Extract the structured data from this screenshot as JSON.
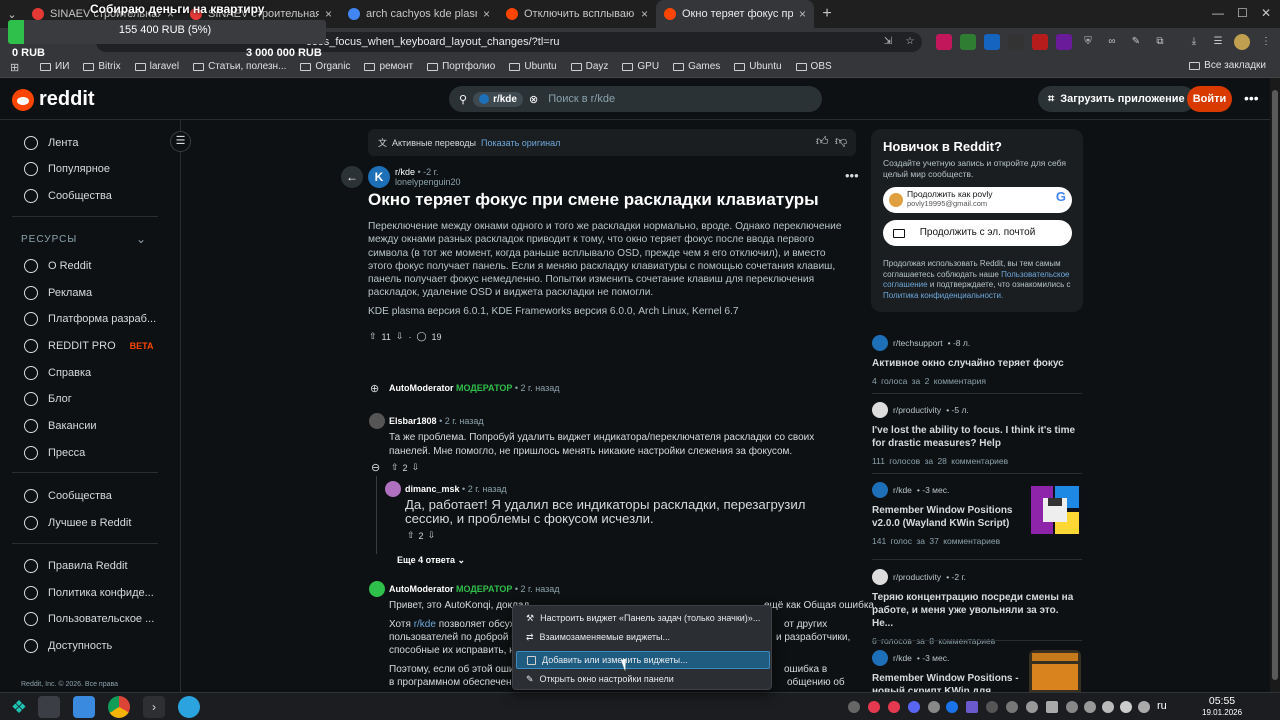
{
  "fundraiser": {
    "title": "Собираю деньги на квартиру",
    "current": "155 400 RUB (5%)",
    "progress_fraction": 0.05,
    "min": "0 RUB",
    "max": "3 000 000 RUB",
    "fill_color": "#2fbf4b"
  },
  "browser": {
    "tabs": [
      {
        "label": "SINAEV строительная к...",
        "icon_color": "#e53935"
      },
      {
        "label": "SINAEV строительная ком...",
        "icon_color": "#e53935"
      },
      {
        "label": "arch cachyos kde plasma k...",
        "icon_color": "#4285f4"
      },
      {
        "label": "Отключить всплывающ...",
        "icon_color": "#ff4500"
      },
      {
        "label": "Окно теряет фокус при см...",
        "icon_color": "#ff4500",
        "active": true
      }
    ],
    "url_visible": "oses_focus_when_keyboard_layout_changes/?tl=ru",
    "bookmarks": [
      "ИИ",
      "Bitrix",
      "laravel",
      "Статьи, полезн...",
      "Organic",
      "ремонт",
      "Портфолио",
      "Ubuntu",
      "Dayz",
      "GPU",
      "Games",
      "Ubuntu",
      "OBS"
    ],
    "all_bookmarks": "Все закладки"
  },
  "header": {
    "logo": "reddit",
    "search_chip": "r/kde",
    "search_placeholder": "Поиск в r/kde",
    "app_button": "Загрузить приложение",
    "login_button": "Войти"
  },
  "sidebar": {
    "main": [
      "Лента",
      "Популярное",
      "Сообщества"
    ],
    "resources_heading": "РЕСУРСЫ",
    "resources": [
      "О Reddit",
      "Реклама",
      "Платформа разраб...",
      "REDDIT PRO",
      "Справка",
      "Блог",
      "Вакансии",
      "Пресса"
    ],
    "beta": "BETA",
    "more": [
      "Сообщества",
      "Лучшее в Reddit"
    ],
    "legal": [
      "Правила Reddit",
      "Политика конфиде...",
      "Пользовательское ...",
      "Доступность"
    ],
    "copyright": "Reddit, Inc. © 2026. Все права"
  },
  "translation": {
    "label": "Активные переводы",
    "show_original": "Показать оригинал"
  },
  "post": {
    "subreddit": "r/kde",
    "age": "• -2 г.",
    "author": "lonelypenguin20",
    "title": "Окно теряет фокус при смене раскладки клавиатуры",
    "body": "Переключение между окнами одного и того же раскладки нормально, вроде. Однако переключение между окнами разных раскладок приводит к тому, что окно теряет фокус после ввода первого символа (в тот же момент, когда раньше всплывало OSD, прежде чем я его отключил), и вместо этого фокус получает панель. Если я меняю раскладку клавиатуры с помощью сочетания клавиш, панель получает фокус немедленно. Попытки изменить сочетание клавиш для переключения раскладок, удаление OSD и виджета раскладки не помогли.",
    "versions": "KDE plasma версия 6.0.1, KDE Frameworks версия 6.0.0, Arch Linux, Kernel 6.7",
    "upvotes": "11",
    "comments": "19"
  },
  "comments": [
    {
      "author": "AutoModerator",
      "role": "МОДЕРАТОР",
      "time": "• 2 г. назад"
    },
    {
      "author": "Elsbar1808",
      "time": "• 2 г. назад",
      "text": "Та же проблема. Попробуй удалить виджет индикатора/переключателя раскладки со своих панелей. Мне помогло, не пришлось менять никакие настройки слежения за фокусом.",
      "votes": "2"
    },
    {
      "author": "dimanc_msk",
      "time": "• 2 г. назад",
      "text": "Да, работает! Я удалил все индикаторы раскладки, перезагрузил сессию, и проблемы с фокусом исчезли.",
      "votes": "2"
    },
    {
      "author": "AutoModerator",
      "role": "МОДЕРАТОР",
      "time": "• 2 г. назад",
      "text": "Привет, это AutoKonqi, доклад...",
      "text2_pre": "Хотя",
      "text2_link": "r/kde",
      "text2_post": "позволяет обсуж...",
      "text3": "пользователей по доброй во...",
      "text4": "способные их исправить, не...",
      "text5": "Поэтому, если об этой ошиб...",
      "text6": "в программном обеспечении К...",
      "right2": "от других",
      "right3": "и разработчики,",
      "right5": "ошибка в",
      "right6": "общению об",
      "right1": "ещё как Общая ошибка."
    }
  ],
  "more_replies": "Еще 4 ответа",
  "context_menu": [
    "Настроить виджет «Панель задач (только значки)»...",
    "Взаимозаменяемые виджеты...",
    "Добавить или изменить виджеты...",
    "Открыть окно настройки панели"
  ],
  "newcard": {
    "title": "Новичок в Reddit?",
    "subtitle": "Создайте учетную запись и откройте для себя целый мир сообществ.",
    "google_name": "Продолжить как povly",
    "google_email": "povly19995@gmail.com",
    "email_button": "Продолжить с эл. почтой",
    "legal_pre": "Продолжая использовать Reddit, вы тем самым соглашаетесь соблюдать наше",
    "legal_link1": "Пользовательское соглашение",
    "legal_mid": "и подтверждаете, что ознакомились с",
    "legal_link2": "Политика конфиденциальности."
  },
  "related": [
    {
      "sub": "r/techsupport",
      "age": "• -8 л.",
      "title": "Активное окно случайно теряет фокус",
      "stats": "4 голоса за   2 комментария"
    },
    {
      "sub": "r/productivity",
      "age": "• -5 л.",
      "title": "I've lost the ability to focus. I think it's time for drastic measures? Help",
      "stats": "111 голосов за   28 комментариев"
    },
    {
      "sub": "r/kde",
      "age": "• -3 мес.",
      "title": "Remember Window Positions v2.0.0 (Wayland KWin Script)",
      "stats": "141 голос за   37 комментариев"
    },
    {
      "sub": "r/productivity",
      "age": "• -2 г.",
      "title": "Теряю концентрацию посреди смены на работе, и меня уже увольняли за это. Не...",
      "stats": "6 голосов за   8 комментариев"
    },
    {
      "sub": "r/kde",
      "age": "• -3 мес.",
      "title": "Remember Window Positions - новый скрипт KWin для...",
      "stats": ""
    }
  ],
  "taskbar": {
    "lang": "ru",
    "time": "05:55",
    "date": "19.01.2026"
  }
}
